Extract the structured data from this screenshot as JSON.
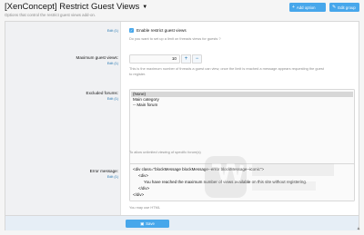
{
  "header": {
    "title": "[XenConcept] Restrict Guest Views",
    "subtitle": "Options that control the restrict guest views add-on.",
    "add_option": "Add option",
    "edit_group": "Edit group"
  },
  "options": {
    "edit_label": "Edit (1)",
    "enable": {
      "label": "Enable restrict guest views",
      "hint": "Do you want to set up a limit on threads views for guests ?"
    },
    "max_views": {
      "label": "Maximum guest views:",
      "value": "10",
      "hint_line1": "This is the maximum number of threads a guest can view, once the limit is reached a message appears requesting the guest",
      "hint_line2": "to register."
    },
    "excluded_forums": {
      "label": "Excluded forums:",
      "items": [
        "(None)",
        "Main category",
        "-- Main forum"
      ],
      "hint": "To allow unlimited viewing of specific forum(s)"
    },
    "error_message": {
      "label": "Error message:",
      "lines": [
        "<div class=\"blockMessage blockMessage--error blockMessage--iconic\">",
        "<div>",
        "You have reached the maximum number of views available on this site without registering.",
        "</div>",
        "</div>"
      ],
      "hint": "You may use HTML"
    }
  },
  "footer": {
    "save": "Save"
  },
  "colors": {
    "accent": "#47a7eb",
    "link": "#2577b1"
  }
}
